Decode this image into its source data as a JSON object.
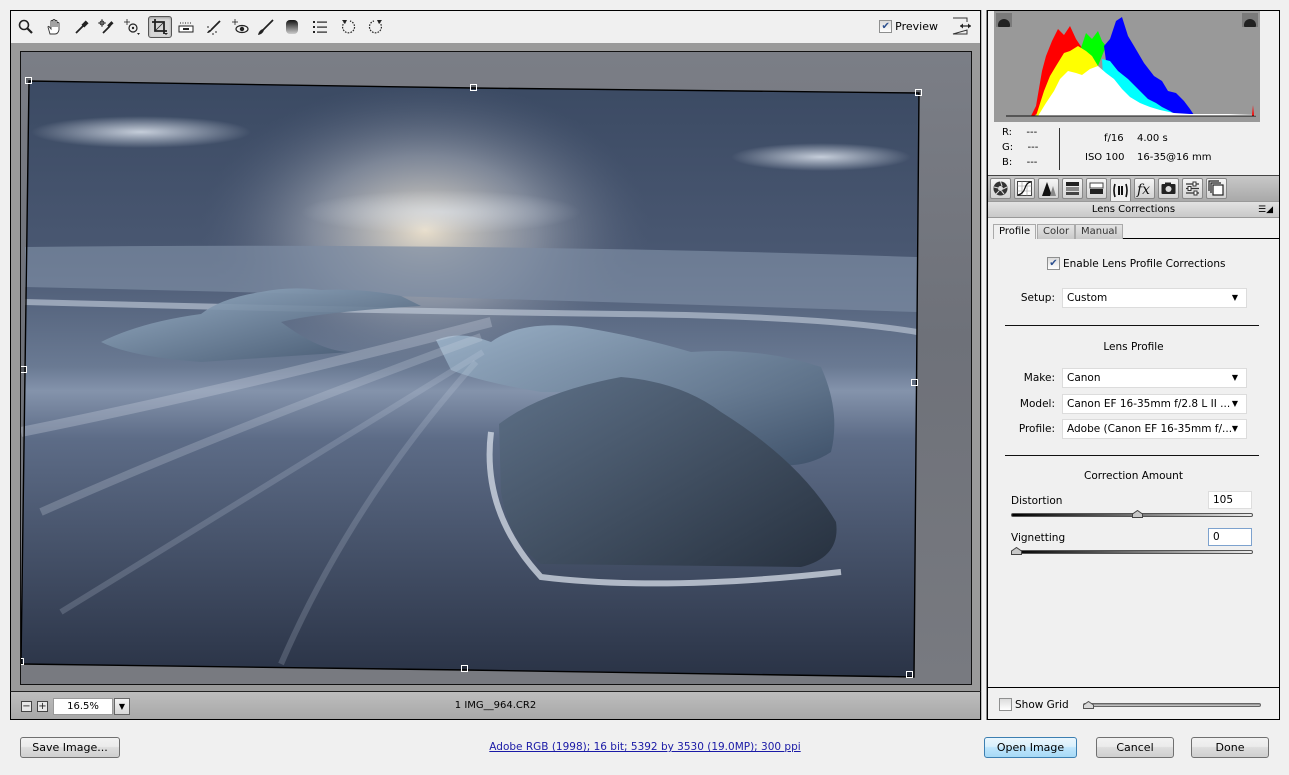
{
  "toolbar": {
    "tools": [
      {
        "name": "zoom-tool",
        "icon": "magnifier-icon"
      },
      {
        "name": "hand-tool",
        "icon": "hand-icon"
      },
      {
        "name": "white-balance-tool",
        "icon": "eyedropper-icon"
      },
      {
        "name": "color-sampler-tool",
        "icon": "color-sampler-icon"
      },
      {
        "name": "targeted-adjustment-tool",
        "icon": "target-adjust-icon"
      },
      {
        "name": "crop-tool",
        "icon": "crop-icon",
        "active": true
      },
      {
        "name": "straighten-tool",
        "icon": "level-icon"
      },
      {
        "name": "spot-removal-tool",
        "icon": "spot-heal-icon"
      },
      {
        "name": "red-eye-removal-tool",
        "icon": "red-eye-icon"
      },
      {
        "name": "adjustment-brush-tool",
        "icon": "brush-icon"
      },
      {
        "name": "graduated-filter-tool",
        "icon": "graduated-filter-icon"
      },
      {
        "name": "preferences-tool",
        "icon": "list-icon"
      },
      {
        "name": "rotate-ccw-tool",
        "icon": "rotate-left-icon"
      },
      {
        "name": "rotate-cw-tool",
        "icon": "rotate-right-icon"
      }
    ],
    "preview_label": "Preview",
    "preview_checked": true
  },
  "status": {
    "zoom_minus": "−",
    "zoom_plus": "+",
    "zoom_value": "16.5%",
    "filename": "1 IMG__964.CR2"
  },
  "histogram": {
    "colors": {
      "red": "#ff0000",
      "yellow": "#ffff00",
      "green": "#00ff00",
      "cyan": "#00ffff",
      "blue": "#0000ff",
      "white": "#ffffff",
      "bg": "#999999"
    }
  },
  "readout": {
    "r_label": "R:",
    "r_value": "---",
    "g_label": "G:",
    "g_value": "---",
    "b_label": "B:",
    "b_value": "---",
    "aperture": "f/16",
    "shutter": "4.00 s",
    "iso": "ISO 100",
    "lens": "16-35@16 mm"
  },
  "panel_tabs": [
    {
      "name": "tab-basic",
      "icon": "aperture-icon"
    },
    {
      "name": "tab-tone-curve",
      "icon": "tone-curve-icon"
    },
    {
      "name": "tab-detail",
      "icon": "detail-icon"
    },
    {
      "name": "tab-hsl",
      "icon": "hsl-grayscale-icon"
    },
    {
      "name": "tab-split-toning",
      "icon": "split-toning-icon"
    },
    {
      "name": "tab-lens-corrections",
      "icon": "lens-icon",
      "active": true
    },
    {
      "name": "tab-effects",
      "icon": "fx-icon"
    },
    {
      "name": "tab-camera-calibration",
      "icon": "camera-icon"
    },
    {
      "name": "tab-presets",
      "icon": "sliders-icon"
    },
    {
      "name": "tab-snapshots",
      "icon": "snapshots-icon"
    }
  ],
  "panel": {
    "title": "Lens Corrections",
    "menu_glyph": "☰◢",
    "subtabs": [
      "Profile",
      "Color",
      "Manual"
    ],
    "active_subtab": "Profile",
    "enable_label": "Enable Lens Profile Corrections",
    "enable_checked": true,
    "setup_label": "Setup:",
    "setup_value": "Custom",
    "lens_profile_title": "Lens Profile",
    "make_label": "Make:",
    "make_value": "Canon",
    "model_label": "Model:",
    "model_value": "Canon EF 16-35mm f/2.8 L II ...",
    "profile_label": "Profile:",
    "profile_value": "Adobe (Canon EF 16-35mm f/...",
    "correction_title": "Correction Amount",
    "distortion_label": "Distortion",
    "distortion_value": "105",
    "distortion_fraction": 0.525,
    "vignetting_label": "Vignetting",
    "vignetting_value": "0",
    "vignetting_fraction": 0.0,
    "show_grid_label": "Show Grid",
    "show_grid_checked": false,
    "grid_fraction": 0.0
  },
  "footer": {
    "save_label": "Save Image...",
    "info_link": "Adobe RGB (1998); 16 bit; 5392 by 3530 (19.0MP); 300 ppi",
    "open_label": "Open Image",
    "cancel_label": "Cancel",
    "done_label": "Done"
  }
}
